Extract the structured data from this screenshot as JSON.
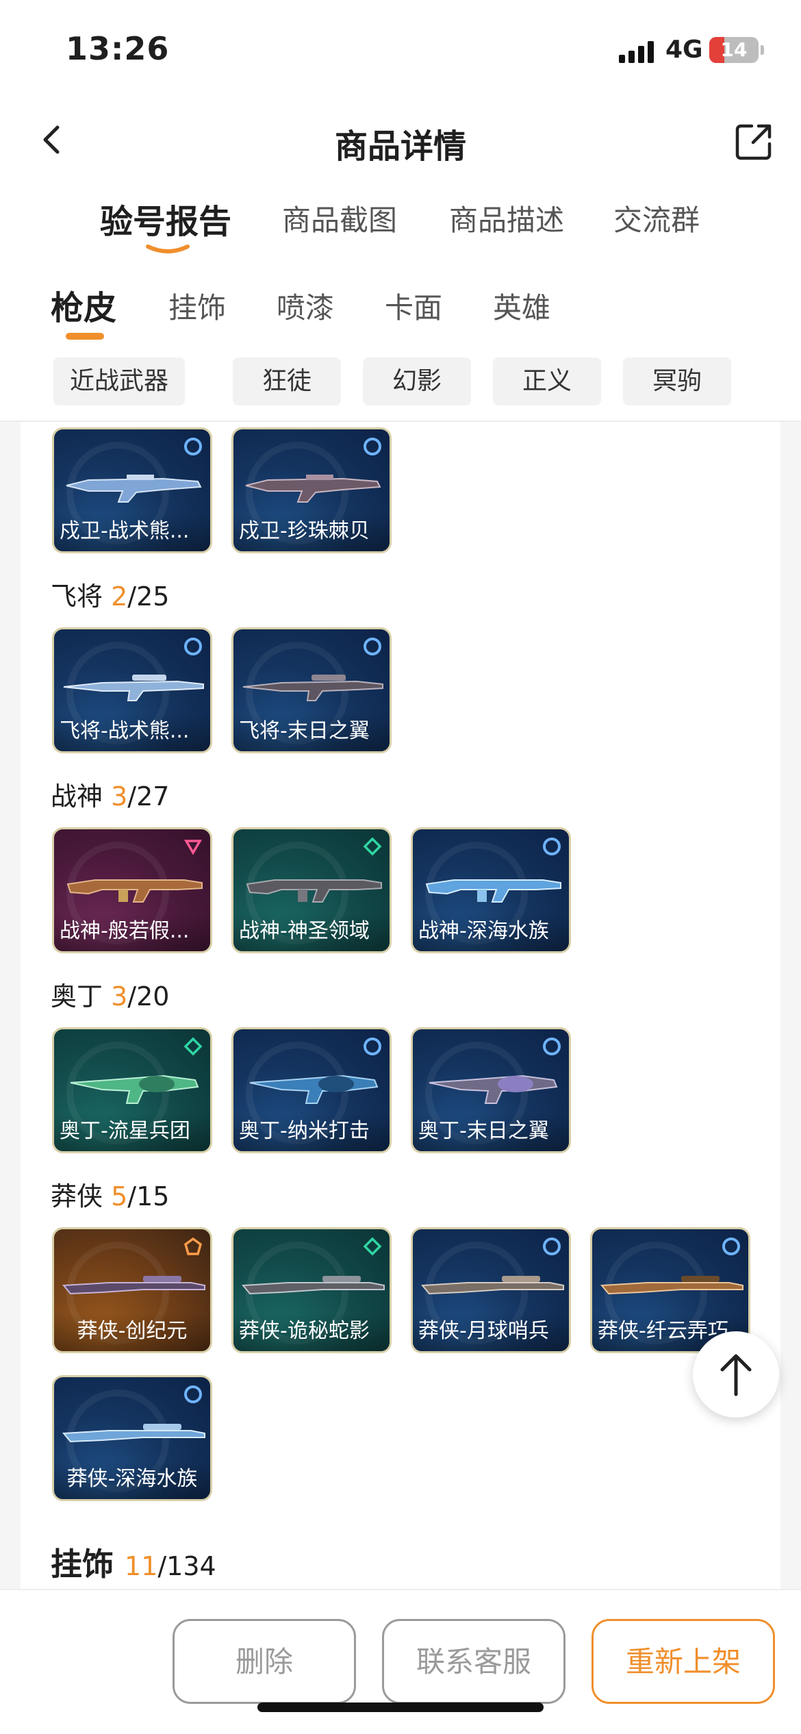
{
  "status_bar": {
    "time": "13:26",
    "network": "4G",
    "battery": "14",
    "battery_level": 0.14
  },
  "nav": {
    "title": "商品详情",
    "back_icon": "chevron-left-icon",
    "share_icon": "share-icon"
  },
  "main_tabs": [
    {
      "label": "验号报告",
      "active": true
    },
    {
      "label": "商品截图",
      "active": false
    },
    {
      "label": "商品描述",
      "active": false
    },
    {
      "label": "交流群",
      "active": false
    }
  ],
  "sub_tabs": [
    {
      "label": "枪皮",
      "active": true
    },
    {
      "label": "挂饰",
      "active": false
    },
    {
      "label": "喷漆",
      "active": false
    },
    {
      "label": "卡面",
      "active": false
    },
    {
      "label": "英雄",
      "active": false
    }
  ],
  "filters": [
    "近战武器",
    "狂徒",
    "幻影",
    "正义",
    "冥驹"
  ],
  "groups": {
    "g1": {
      "skins": [
        {
          "name": "戍卫-战术熊...",
          "tier": "blue"
        },
        {
          "name": "戍卫-珍珠棘贝",
          "tier": "blue"
        }
      ]
    },
    "g2": {
      "title": "飞将",
      "owned": "2",
      "total": "/25",
      "skins": [
        {
          "name": "飞将-战术熊...",
          "tier": "blue"
        },
        {
          "name": "飞将-末日之翼",
          "tier": "blue"
        }
      ]
    },
    "g3": {
      "title": "战神",
      "owned": "3",
      "total": "/27",
      "skins": [
        {
          "name": "战神-般若假...",
          "tier": "purple"
        },
        {
          "name": "战神-神圣领域",
          "tier": "green"
        },
        {
          "name": "战神-深海水族",
          "tier": "blue"
        }
      ]
    },
    "g4": {
      "title": "奥丁",
      "owned": "3",
      "total": "/20",
      "skins": [
        {
          "name": "奥丁-流星兵团",
          "tier": "green"
        },
        {
          "name": "奥丁-纳米打击",
          "tier": "blue"
        },
        {
          "name": "奥丁-末日之翼",
          "tier": "blue"
        }
      ]
    },
    "g5": {
      "title": "莽侠",
      "owned": "5",
      "total": "/15",
      "skins": [
        {
          "name": "莽侠-创纪元",
          "tier": "orange"
        },
        {
          "name": "莽侠-诡秘蛇影",
          "tier": "green"
        },
        {
          "name": "莽侠-月球哨兵",
          "tier": "blue"
        },
        {
          "name": "莽侠-纤云弄巧",
          "tier": "blue"
        },
        {
          "name": "莽侠-深海水族",
          "tier": "blue"
        }
      ]
    }
  },
  "next_section": {
    "title": "挂饰",
    "owned": "11",
    "total": "/134"
  },
  "actions": {
    "delete": "删除",
    "contact": "联系客服",
    "relist": "重新上架"
  },
  "colors": {
    "accent": "#f08f2c",
    "tier_blue": "#14345f",
    "tier_green": "#124a4a",
    "tier_purple": "#4c1a3c",
    "tier_orange": "#6e3d17"
  }
}
